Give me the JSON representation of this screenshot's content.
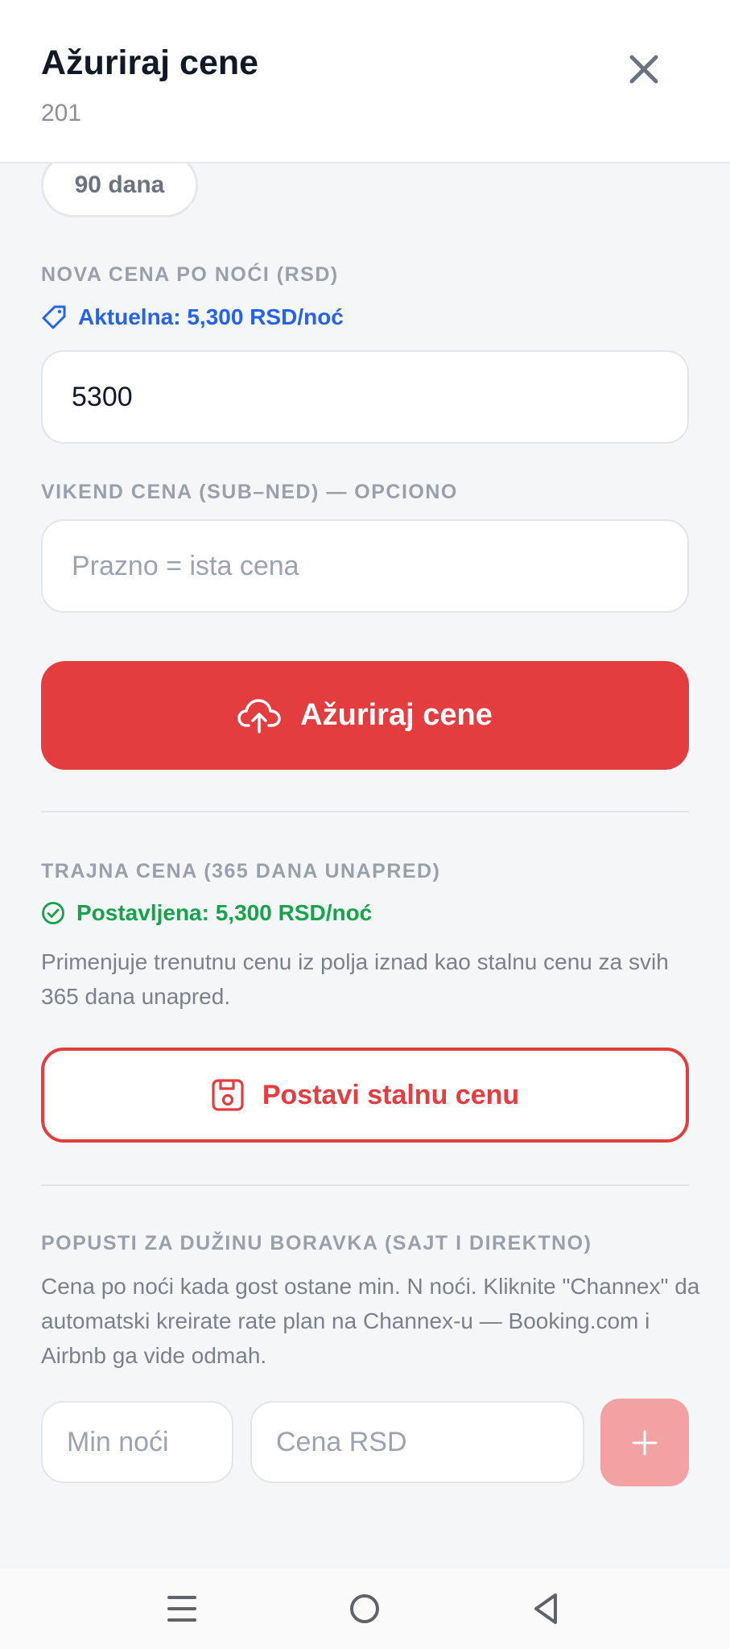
{
  "header": {
    "title": "Ažuriraj cene",
    "subtitle": "201"
  },
  "range_pill": {
    "label": "90 dana"
  },
  "new_price": {
    "label": "NOVA CENA PO NOĆI (RSD)",
    "current": "Aktuelna: 5,300 RSD/noć",
    "value": "5300"
  },
  "weekend_price": {
    "label": "VIKEND CENA (SUB–NED) — OPCIONO",
    "value": "",
    "placeholder": "Prazno = ista cena"
  },
  "update_button": {
    "label": "Ažuriraj cene",
    "icon": "cloud-upload-icon"
  },
  "permanent": {
    "label": "TRAJNA CENA (365 DANA UNAPRED)",
    "status": "Postavljena: 5,300 RSD/noć",
    "description": "Primenjuje trenutnu cenu iz polja iznad kao stalnu cenu za svih 365 dana unapred.",
    "button_label": "Postavi stalnu cenu",
    "button_icon": "save-icon"
  },
  "discounts": {
    "label": "POPUSTI ZA DUŽINU BORAVKA (SAJT I DIREKTNO)",
    "description": "Cena po noći kada gost ostane min. N noći. Kliknite \"Channex\" da automatski kreirate rate plan na Channex-u — Booking.com i Airbnb ga vide odmah.",
    "min_nights_placeholder": "Min noći",
    "price_placeholder": "Cena RSD",
    "add_icon": "plus-icon"
  },
  "colors": {
    "accent": "#e33d40",
    "accent_disabled": "#f3a2a4",
    "info_blue": "#2563eb",
    "success_green": "#16a34a"
  },
  "navbar": {
    "icons": [
      "menu-icon",
      "home-icon",
      "back-icon"
    ]
  }
}
